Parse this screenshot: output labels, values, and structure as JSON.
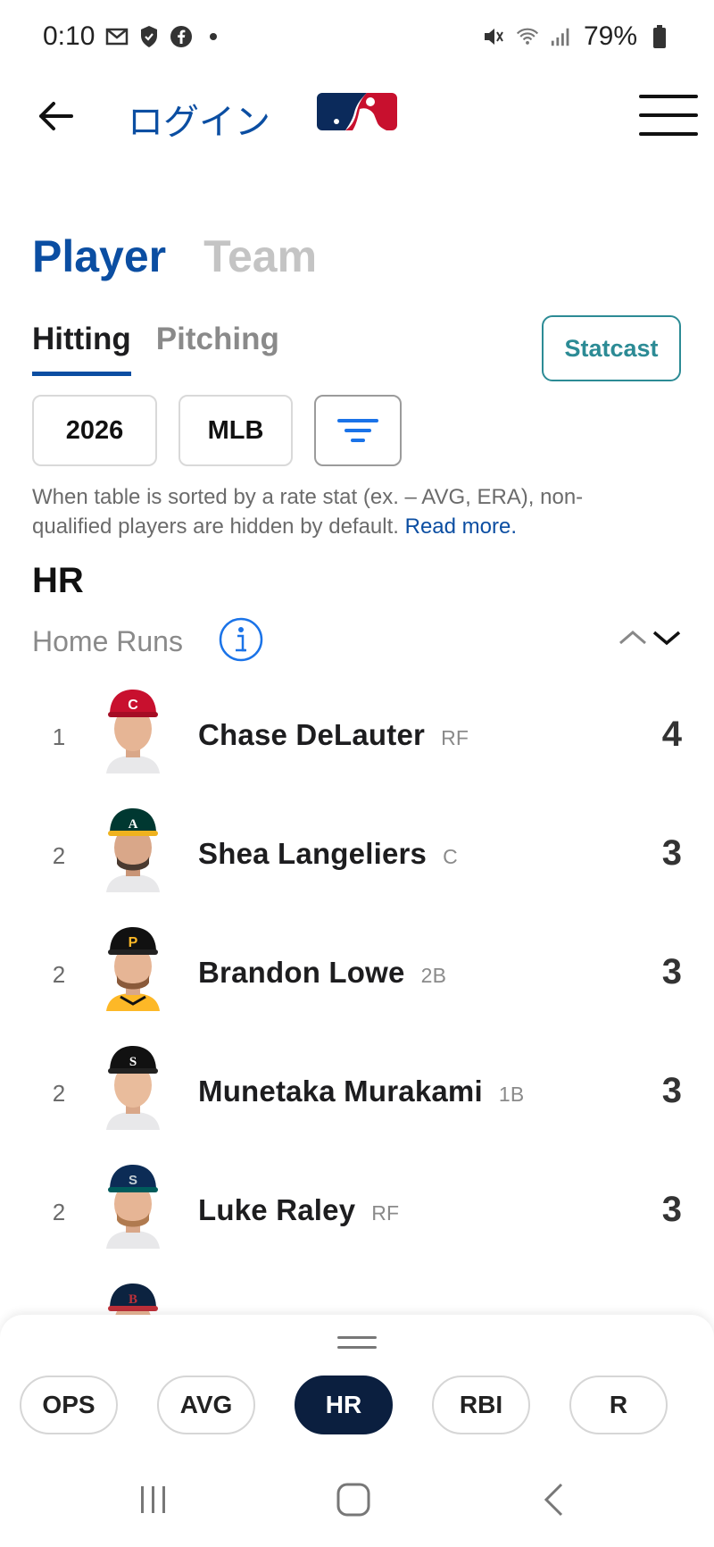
{
  "status_bar": {
    "time": "0:10",
    "battery": "79%"
  },
  "header": {
    "login_label": "ログイン"
  },
  "main_tabs": [
    {
      "label": "Player",
      "active": true
    },
    {
      "label": "Team",
      "active": false
    }
  ],
  "sub_tabs": [
    {
      "label": "Hitting",
      "active": true
    },
    {
      "label": "Pitching",
      "active": false
    }
  ],
  "statcast_label": "Statcast",
  "filters": {
    "season": "2026",
    "league": "MLB"
  },
  "note": {
    "text": "When table is sorted by a rate stat (ex. – AVG, ERA), non-qualified players are hidden by default.",
    "link": "Read more."
  },
  "stat": {
    "abbr": "HR",
    "full": "Home Runs"
  },
  "players": [
    {
      "rank": "1",
      "name": "Chase DeLauter",
      "pos": "RF",
      "value": "4",
      "cap_color": "#c8102e",
      "cap_letter": "C"
    },
    {
      "rank": "2",
      "name": "Shea Langeliers",
      "pos": "C",
      "value": "3",
      "cap_color": "#003831",
      "cap_letter": "A"
    },
    {
      "rank": "2",
      "name": "Brandon Lowe",
      "pos": "2B",
      "value": "3",
      "cap_color": "#111111",
      "cap_letter": "P"
    },
    {
      "rank": "2",
      "name": "Munetaka Murakami",
      "pos": "1B",
      "value": "3",
      "cap_color": "#111111",
      "cap_letter": "S"
    },
    {
      "rank": "2",
      "name": "Luke Raley",
      "pos": "RF",
      "value": "3",
      "cap_color": "#0c2c56",
      "cap_letter": "S"
    }
  ],
  "stat_chips": [
    {
      "label": "OPS",
      "active": false
    },
    {
      "label": "AVG",
      "active": false
    },
    {
      "label": "HR",
      "active": true
    },
    {
      "label": "RBI",
      "active": false
    },
    {
      "label": "R",
      "active": false
    }
  ],
  "icons": {
    "back": "arrow-left-icon",
    "menu": "hamburger-menu-icon",
    "sort": "sort-lines-icon",
    "info": "info-icon",
    "sort_arrows": "sort-up-down-icon"
  },
  "colors": {
    "brand_blue": "#0b4ea2",
    "teal": "#2c8b95",
    "navy": "#0b1f3f"
  }
}
